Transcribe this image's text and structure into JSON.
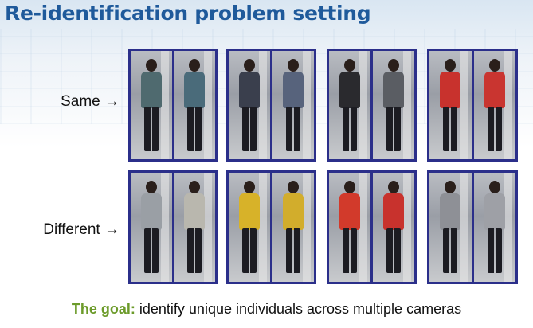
{
  "slide": {
    "title": "Re-identification problem setting",
    "row_labels": {
      "same": "Same →",
      "different": "Different →"
    },
    "goal_lead": "The goal:",
    "goal_text": " identify unique individuals across multiple cameras"
  },
  "rows": [
    {
      "name": "same",
      "pairs": [
        {
          "a": "#4f6a6f",
          "b": "#4a6b7a"
        },
        {
          "a": "#3a3f4d",
          "b": "#57637c"
        },
        {
          "a": "#2a2a2e",
          "b": "#5a5d63"
        },
        {
          "a": "#c8322d",
          "b": "#c93530"
        }
      ]
    },
    {
      "name": "different",
      "pairs": [
        {
          "a": "#9a9fa5",
          "b": "#b9b7ae"
        },
        {
          "a": "#d7b229",
          "b": "#d2ad2c"
        },
        {
          "a": "#d23a2b",
          "b": "#c8322d"
        },
        {
          "a": "#8e9096",
          "b": "#9ea0a6"
        }
      ]
    }
  ]
}
